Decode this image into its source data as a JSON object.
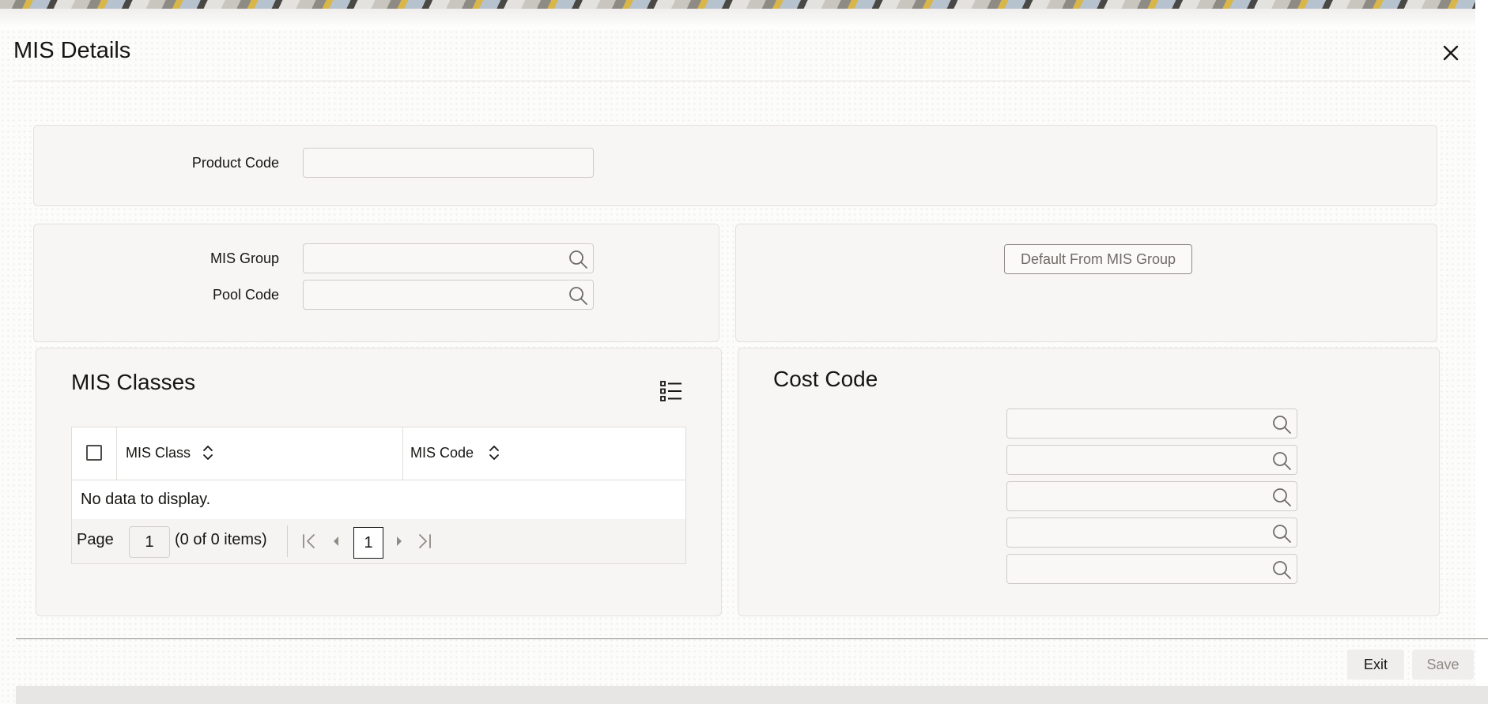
{
  "dialog": {
    "title": "MIS Details"
  },
  "product": {
    "product_code_label": "Product Code",
    "product_code_value": ""
  },
  "mis_group_section": {
    "mis_group_label": "MIS Group",
    "mis_group_value": "",
    "pool_code_label": "Pool Code",
    "pool_code_value": "",
    "default_button_label": "Default From MIS Group"
  },
  "mis_classes": {
    "title": "MIS Classes",
    "columns": [
      "MIS Class",
      "MIS Code"
    ],
    "empty_text": "No data to display.",
    "pager": {
      "page_label": "Page",
      "page_value": "1",
      "items_text": "(0 of 0 items)",
      "current_page": "1"
    }
  },
  "cost_code": {
    "title": "Cost Code",
    "fields": [
      "",
      "",
      "",
      "",
      ""
    ]
  },
  "footer": {
    "exit_label": "Exit",
    "save_label": "Save"
  },
  "icons": [
    "close-icon",
    "search-icon",
    "list-view-icon",
    "sort-icon",
    "first-page-icon",
    "previous-page-icon",
    "next-page-icon",
    "last-page-icon"
  ],
  "colors": {
    "text": "#161513",
    "panel": "#f7f6f5",
    "border": "#e4e1dd",
    "disabled_text": "#8f8b86"
  }
}
